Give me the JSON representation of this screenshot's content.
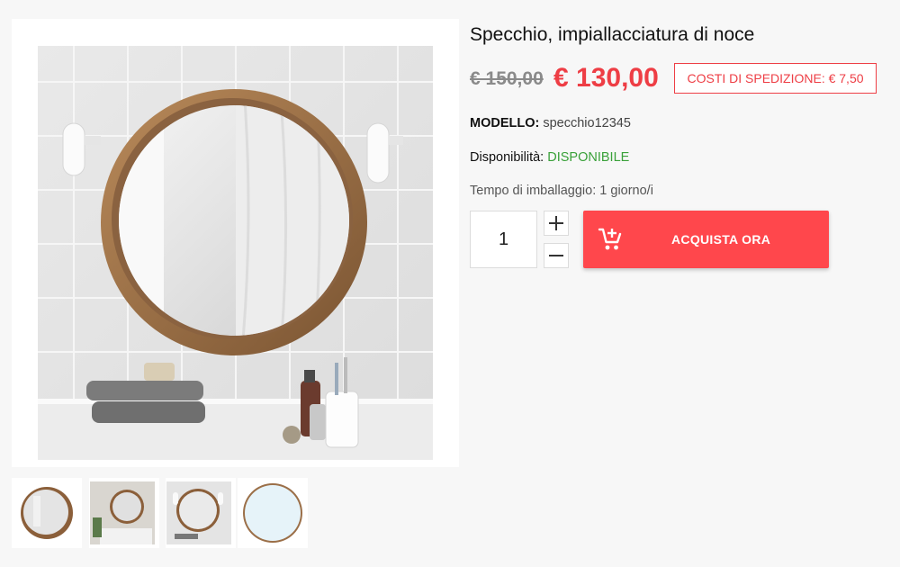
{
  "product": {
    "title": "Specchio, impiallacciatura di noce",
    "old_price": "€ 150,00",
    "price": "€ 130,00",
    "shipping": "COSTI DI SPEDIZIONE: € 7,50",
    "model_label": "MODELLO:",
    "model_value": "specchio12345",
    "availability_label": "Disponibilità:",
    "availability_value": "DISPONIBILE",
    "packaging_label": "Tempo di imballaggio:",
    "packaging_value": "1 giorno/i"
  },
  "purchase": {
    "quantity": "1",
    "buy_label": "ACQUISTA ORA",
    "buy_icon": "add-to-cart-icon",
    "plus_icon": "plus-icon",
    "minus_icon": "minus-icon"
  },
  "gallery": {
    "main_image": "round-walnut-mirror-bathroom-photo",
    "thumbnails": [
      "mirror-front-thumbnail",
      "mirror-bathroom-thumbnail",
      "mirror-wall-lamps-thumbnail",
      "mirror-glass-thumbnail"
    ]
  },
  "colors": {
    "accent": "#ff474c",
    "price_red": "#ee3e45",
    "available_green": "#3aa13a",
    "old_price_gray": "#8a8a8a",
    "background": "#f7f7f7"
  }
}
